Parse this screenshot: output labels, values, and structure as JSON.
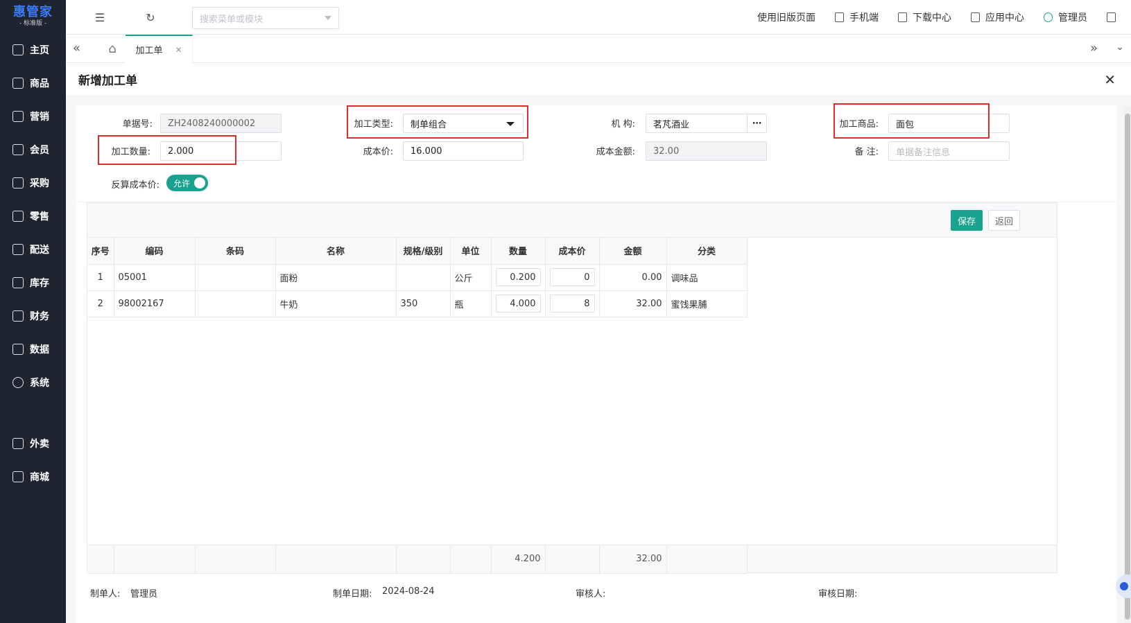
{
  "sidebar": {
    "logo_main": "惠管家",
    "logo_sub": "- 标准版 -",
    "items": [
      {
        "label": "主页"
      },
      {
        "label": "商品"
      },
      {
        "label": "营销"
      },
      {
        "label": "会员"
      },
      {
        "label": "采购"
      },
      {
        "label": "零售"
      },
      {
        "label": "配送"
      },
      {
        "label": "库存"
      },
      {
        "label": "财务"
      },
      {
        "label": "数据"
      },
      {
        "label": "系统"
      }
    ],
    "extra_items": [
      {
        "label": "外卖"
      },
      {
        "label": "商城"
      }
    ]
  },
  "topbar": {
    "search_placeholder": "搜索菜单或模块",
    "links": [
      "使用旧版页面",
      "手机端",
      "下载中心",
      "应用中心",
      "管理员"
    ]
  },
  "tabs": {
    "active": "加工单"
  },
  "panel": {
    "title": "新增加工单"
  },
  "form": {
    "doc_no_label": "单据号:",
    "doc_no": "ZH2408240000002",
    "type_label": "加工类型:",
    "type_value": "制单组合",
    "org_label": "机 构:",
    "org_value": "茗芃酒业",
    "product_label": "加工商品:",
    "product_value": "面包",
    "qty_label": "加工数量:",
    "qty_value": "2.000",
    "cost_label": "成本价:",
    "cost_value": "16.000",
    "amount_label": "成本金额:",
    "amount_value": "32.00",
    "remark_label": "备 注:",
    "remark_placeholder": "单据备注信息",
    "reverse_label": "反算成本价:",
    "reverse_toggle": "允许"
  },
  "grid": {
    "save_label": "保存",
    "back_label": "返回",
    "headers": [
      "序号",
      "编码",
      "条码",
      "名称",
      "规格/级别",
      "单位",
      "数量",
      "成本价",
      "金额",
      "分类"
    ],
    "rows": [
      {
        "no": "1",
        "code": "05001",
        "barcode": "",
        "name": "面粉",
        "spec": "",
        "unit": "公斤",
        "qty": "0.200",
        "cost": "0",
        "amount": "0.00",
        "category": "调味品"
      },
      {
        "no": "2",
        "code": "98002167",
        "barcode": "",
        "name": "牛奶",
        "spec": "350",
        "unit": "瓶",
        "qty": "4.000",
        "cost": "8",
        "amount": "32.00",
        "category": "蜜饯果脯"
      }
    ],
    "sum_qty": "4.200",
    "sum_amount": "32.00"
  },
  "footer": {
    "maker_label": "制单人:",
    "maker": "管理员",
    "date_label": "制单日期:",
    "date": "2024-08-24",
    "auditor_label": "审核人:",
    "audit_date_label": "审核日期:"
  }
}
